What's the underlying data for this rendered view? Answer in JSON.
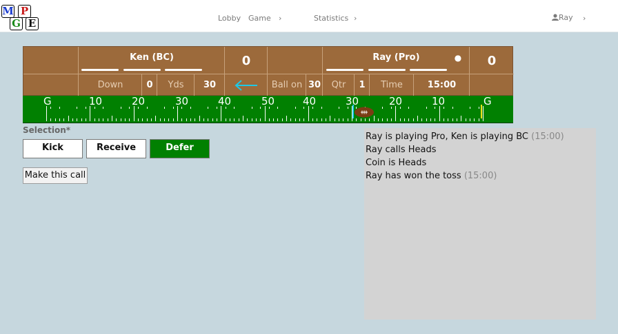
{
  "logo": {
    "letters": [
      "M",
      "P",
      "G",
      "E"
    ]
  },
  "nav": {
    "lobby": "Lobby",
    "game": "Game",
    "statistics": "Statistics",
    "user": "Ray",
    "chevron": "›"
  },
  "scoreboard": {
    "home": {
      "name": "Ken (BC)",
      "score": "0"
    },
    "away": {
      "name": "Ray (Pro)",
      "score": "0",
      "possession": "●"
    },
    "down_label": "Down",
    "down": "0",
    "yds_label": "Yds",
    "yds": "30",
    "direction_arrow": "←",
    "ball_on_label": "Ball on",
    "ball_on": "30",
    "qtr_label": "Qtr",
    "qtr": "1",
    "time_label": "Time",
    "time": "15:00"
  },
  "field": {
    "yard_labels": [
      "G",
      "10",
      "20",
      "30",
      "40",
      "50",
      "40",
      "30",
      "20",
      "10",
      "G"
    ],
    "ball_on_yardline": 30
  },
  "selection": {
    "label": "Selection*",
    "options": [
      {
        "label": "Kick",
        "selected": false
      },
      {
        "label": "Receive",
        "selected": false
      },
      {
        "label": "Defer",
        "selected": true
      }
    ],
    "submit_label": "Make this call"
  },
  "log": [
    {
      "text": "Ray is playing Pro, Ken is playing BC",
      "time": "(15:00)"
    },
    {
      "text": "Ray calls Heads",
      "time": ""
    },
    {
      "text": "Coin is Heads",
      "time": ""
    },
    {
      "text": "Ray has won the toss",
      "time": "(15:00)"
    }
  ],
  "colors": {
    "board": "#9c6a3b",
    "field": "#018001",
    "arrow": "#1ec8e6",
    "background": "#c6d7de",
    "log_panel": "#d3d3d3"
  }
}
